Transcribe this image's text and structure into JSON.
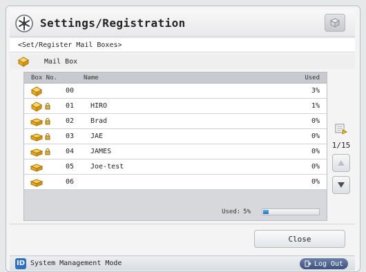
{
  "header": {
    "title": "Settings/Registration"
  },
  "breadcrumb": "<Set/Register Mail Boxes>",
  "mailbox": {
    "label": "Mail Box"
  },
  "table": {
    "headers": {
      "box_no": "Box No.",
      "name": "Name",
      "used": "Used"
    },
    "rows": [
      {
        "no": "00",
        "name": "",
        "used": "3%",
        "locked": false,
        "open": true
      },
      {
        "no": "01",
        "name": "HIRO",
        "used": "1%",
        "locked": true,
        "open": true
      },
      {
        "no": "02",
        "name": "Brad",
        "used": "0%",
        "locked": true,
        "open": false
      },
      {
        "no": "03",
        "name": "JAE",
        "used": "0%",
        "locked": true,
        "open": false
      },
      {
        "no": "04",
        "name": "JAMES",
        "used": "0%",
        "locked": true,
        "open": false
      },
      {
        "no": "05",
        "name": "Joe-test",
        "used": "0%",
        "locked": false,
        "open": false
      },
      {
        "no": "06",
        "name": "",
        "used": "0%",
        "locked": false,
        "open": false
      }
    ],
    "used_label": "Used:",
    "used_value": "5%",
    "used_fraction": 0.05
  },
  "pager": {
    "page": "1/15"
  },
  "buttons": {
    "close": "Close",
    "logout": "Log Out"
  },
  "statusbar": {
    "mode": "System Management Mode"
  },
  "colors": {
    "accent": "#2f6fbc",
    "progress": "#1f6fb3",
    "logout_bg": "#3d5280"
  },
  "icons": {
    "title": "settings-gear-icon",
    "mailbox": "mailbox-icon",
    "lock": "lock-icon",
    "print": "print-list-icon",
    "scroll_up": "arrow-up-icon",
    "scroll_down": "arrow-down-icon",
    "id": "id-icon",
    "logout": "logout-icon"
  }
}
